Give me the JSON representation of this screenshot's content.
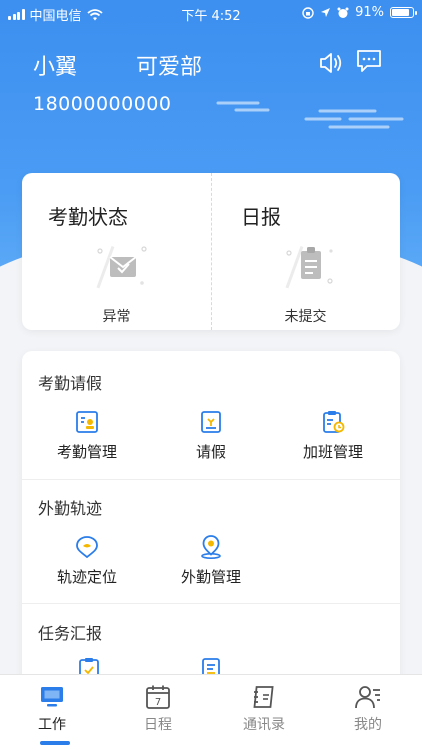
{
  "status_bar": {
    "carrier": "中国电信",
    "time": "下午 4:52",
    "battery": "91%",
    "battery_level": 0.91
  },
  "user": {
    "name": "小翼",
    "department": "可爱部",
    "phone": "18000000000"
  },
  "status_cards": [
    {
      "title": "考勤状态",
      "status": "异常"
    },
    {
      "title": "日报",
      "status": "未提交"
    }
  ],
  "sections": [
    {
      "title": "考勤请假",
      "items": [
        {
          "label": "考勤管理"
        },
        {
          "label": "请假"
        },
        {
          "label": "加班管理"
        }
      ]
    },
    {
      "title": "外勤轨迹",
      "items": [
        {
          "label": "轨迹定位"
        },
        {
          "label": "外勤管理"
        }
      ]
    },
    {
      "title": "任务汇报",
      "items": []
    }
  ],
  "tabs": [
    {
      "label": "工作",
      "icon": "monitor-icon"
    },
    {
      "label": "日程",
      "icon": "calendar-icon",
      "calendar_day": "7"
    },
    {
      "label": "通讯录",
      "icon": "contacts-icon"
    },
    {
      "label": "我的",
      "icon": "user-icon"
    }
  ],
  "colors": {
    "header_blue": "#3d8ff0",
    "accent_blue": "#2b7de9",
    "icon_yellow": "#f5b800"
  }
}
